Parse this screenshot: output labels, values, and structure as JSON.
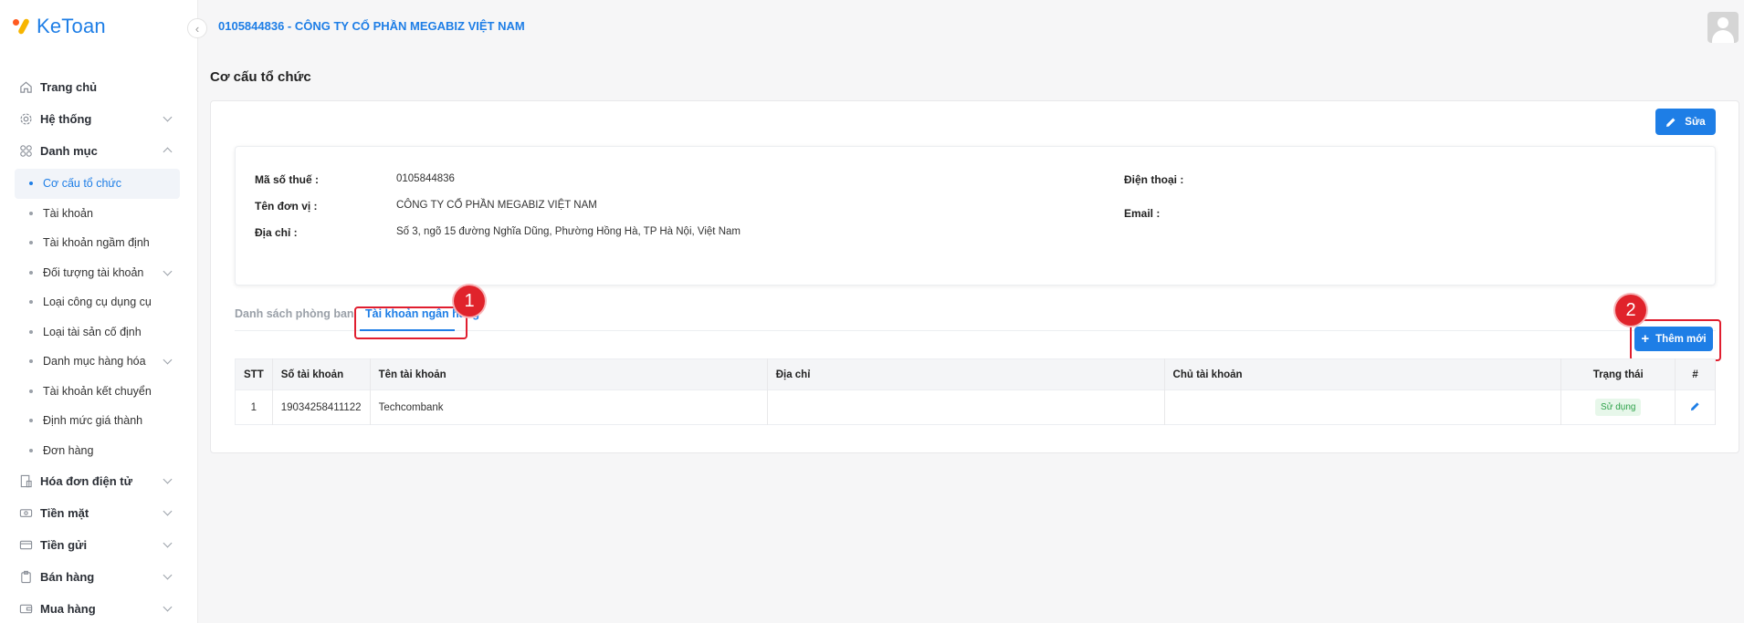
{
  "app": {
    "logo_text": "KeToan"
  },
  "header": {
    "company_title": "0105844836 - CÔNG TY CỔ PHẦN MEGABIZ VIỆT NAM"
  },
  "sidebar": {
    "items": [
      {
        "label": "Trang chủ",
        "icon": "home-icon"
      },
      {
        "label": "Hệ thống",
        "icon": "gear-icon",
        "expandable": true
      },
      {
        "label": "Danh mục",
        "icon": "grid-icon",
        "expanded": true
      }
    ],
    "sub_items": [
      {
        "label": "Cơ cấu tổ chức",
        "active": true
      },
      {
        "label": "Tài khoản"
      },
      {
        "label": "Tài khoản ngầm định"
      },
      {
        "label": "Đối tượng tài khoản",
        "expandable": true
      },
      {
        "label": "Loại công cụ dụng cụ"
      },
      {
        "label": "Loại tài sản cố định"
      },
      {
        "label": "Danh mục hàng hóa",
        "expandable": true
      },
      {
        "label": "Tài khoản kết chuyển"
      },
      {
        "label": "Định mức giá thành"
      },
      {
        "label": "Đơn hàng"
      }
    ],
    "bottom_items": [
      {
        "label": "Hóa đơn điện tử",
        "icon": "invoice-icon"
      },
      {
        "label": "Tiền mặt",
        "icon": "cash-icon"
      },
      {
        "label": "Tiền gửi",
        "icon": "wallet-icon"
      },
      {
        "label": "Bán hàng",
        "icon": "sales-icon"
      },
      {
        "label": "Mua hàng",
        "icon": "purchase-icon"
      }
    ]
  },
  "page": {
    "title": "Cơ cấu tổ chức",
    "edit_label": "Sửa",
    "info": {
      "tax_code_label": "Mã số thuế :",
      "tax_code_value": "0105844836",
      "unit_name_label": "Tên đơn vị :",
      "unit_name_value": "CÔNG TY CỔ PHẦN MEGABIZ VIỆT NAM",
      "address_label": "Địa chỉ :",
      "address_value": "Số 3, ngõ 15 đường Nghĩa Dũng, Phường Hồng Hà, TP Hà Nội, Việt Nam",
      "phone_label": "Điện thoại :",
      "email_label": "Email :"
    },
    "tabs": [
      {
        "label": "Danh sách phòng ban",
        "active": false
      },
      {
        "label": "Tài khoản ngân hàng",
        "active": true
      }
    ],
    "add_label": "Thêm mới",
    "annotations": [
      "1",
      "2"
    ],
    "table": {
      "headers": [
        "STT",
        "Số tài khoản",
        "Tên tài khoản",
        "Địa chỉ",
        "Chủ tài khoản",
        "Trạng thái",
        "#"
      ],
      "rows": [
        {
          "stt": "1",
          "account_no": "19034258411122",
          "account_name": "Techcombank",
          "address": "",
          "owner": "",
          "status": "Sử dụng"
        }
      ]
    }
  },
  "colors": {
    "accent": "#1e7ee6",
    "annotation": "#e0232b",
    "status_ok": "#2ea24a"
  }
}
